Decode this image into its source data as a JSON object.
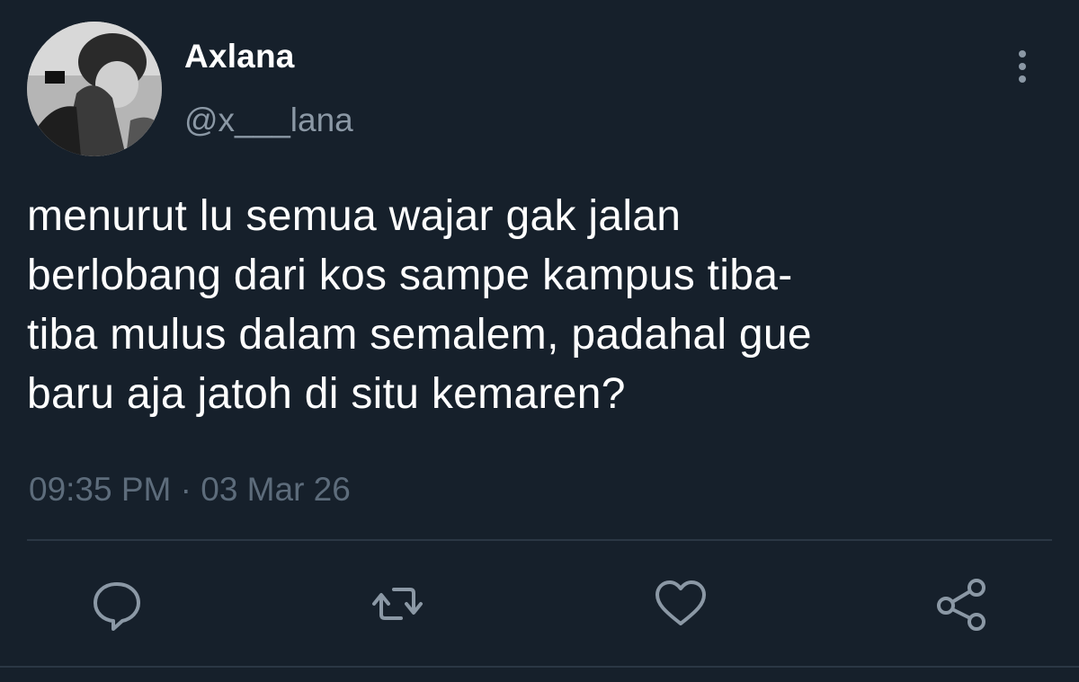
{
  "tweet": {
    "display_name": "Axlana",
    "handle": "@x___lana",
    "text_lines": [
      "menurut lu semua wajar gak jalan",
      "berlobang dari kos sampe kampus tiba-",
      "tiba mulus dalam semalem, padahal gue",
      "baru aja jatoh di situ kemaren?"
    ],
    "timestamp": "09:35 PM · 03 Mar 26"
  },
  "actions": {
    "icons": [
      "reply-icon",
      "retweet-icon",
      "like-icon",
      "share-icon"
    ]
  },
  "colors": {
    "background": "#16202b",
    "text": "#ffffff",
    "secondary_text": "#8b98a5",
    "divider": "#2b3744"
  }
}
